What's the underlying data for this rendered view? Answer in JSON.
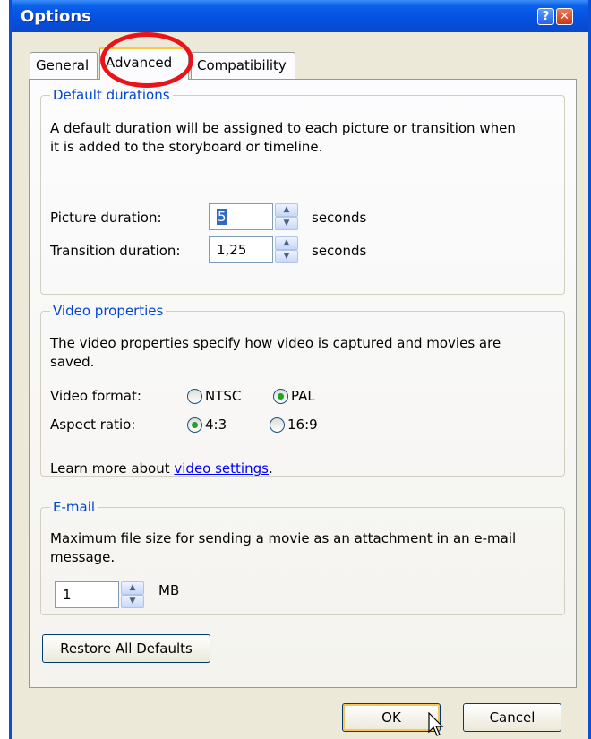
{
  "window": {
    "title": "Options"
  },
  "tabs": [
    {
      "label": "General"
    },
    {
      "label": "Advanced"
    },
    {
      "label": "Compatibility"
    }
  ],
  "default_durations": {
    "legend": "Default durations",
    "description_line1": "A default duration will be assigned to each picture or transition when",
    "description_line2": "it is added to the storyboard or timeline.",
    "picture_label": "Picture duration:",
    "picture_value": "5",
    "transition_label": "Transition duration:",
    "transition_value": "1,25",
    "unit": "seconds"
  },
  "video_properties": {
    "legend": "Video properties",
    "description_line1": "The video properties specify how video is captured and movies are",
    "description_line2": "saved.",
    "format_label": "Video format:",
    "format_options": [
      "NTSC",
      "PAL"
    ],
    "format_selected": "PAL",
    "aspect_label": "Aspect ratio:",
    "aspect_options": [
      "4:3",
      "16:9"
    ],
    "aspect_selected": "4:3",
    "learn_more_prefix": "Learn more about ",
    "learn_more_link": "video settings",
    "learn_more_suffix": "."
  },
  "email": {
    "legend": "E-mail",
    "description_line1": "Maximum file size for sending a movie as an attachment in an e-mail",
    "description_line2": "message.",
    "size_value": "1",
    "unit": "MB"
  },
  "buttons": {
    "restore": "Restore All Defaults",
    "ok": "OK",
    "cancel": "Cancel"
  },
  "colors": {
    "titlebar": "#0a5fe8",
    "annotation": "#e8141a",
    "legend_text": "#0046d5",
    "link": "#0000ff"
  }
}
